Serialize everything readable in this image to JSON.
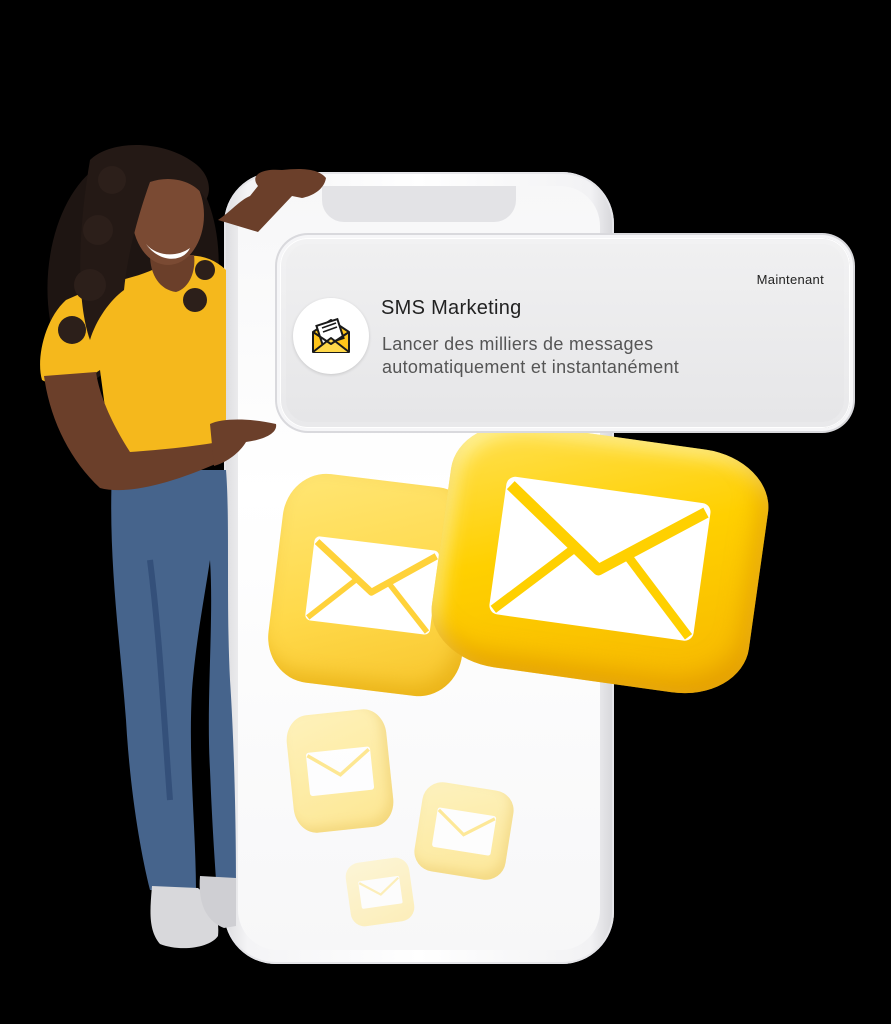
{
  "notification": {
    "time": "Maintenant",
    "title": "SMS Marketing",
    "body_line1": "Lancer des milliers de messages",
    "body_line2": "automatiquement et instantanément",
    "app_icon": "envelope-document-icon"
  },
  "colors": {
    "accent_yellow": "#ffd000",
    "shirt_yellow": "#f5b81c",
    "jeans_blue": "#3d5f8a",
    "phone_white": "#f7f7f8",
    "background": "#000000"
  }
}
